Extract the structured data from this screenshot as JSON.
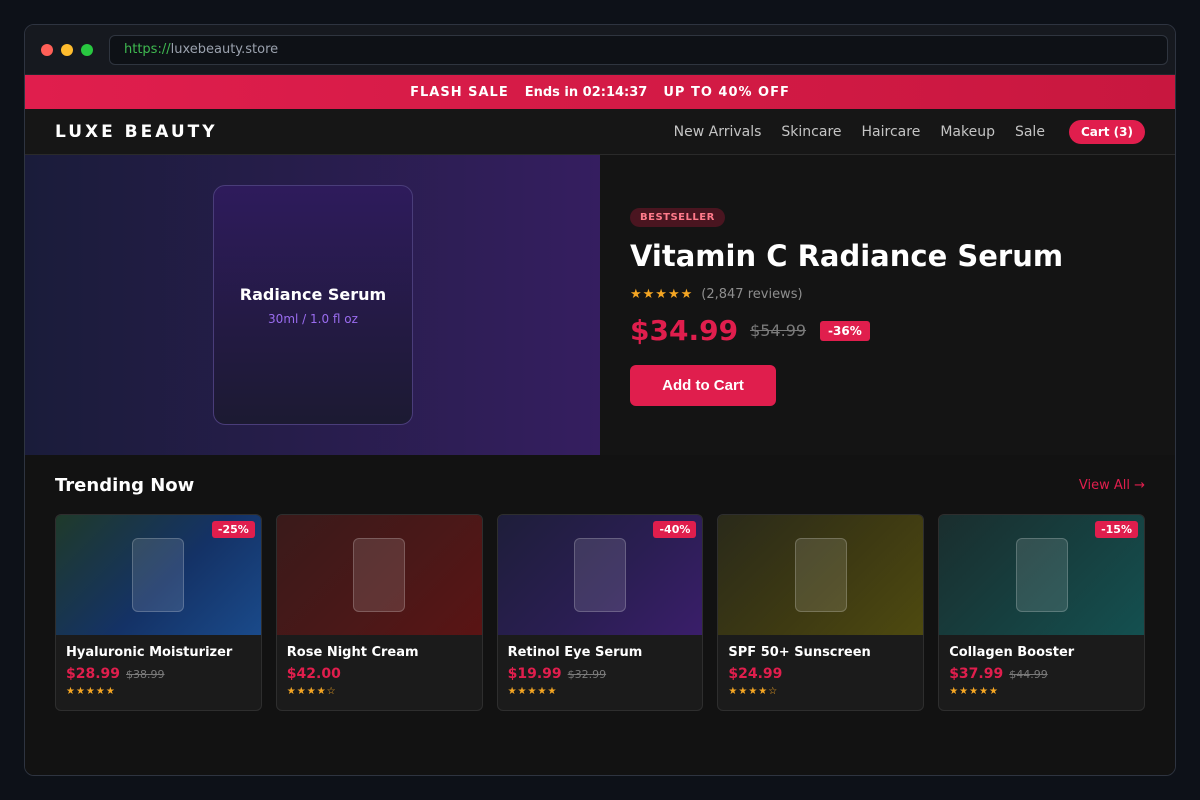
{
  "browser": {
    "url_scheme": "https://",
    "url_host": "luxebeauty.store"
  },
  "flash_bar": {
    "label": "FLASH SALE",
    "timer": "Ends in 02:14:37",
    "offer": "UP TO 40% OFF"
  },
  "nav": {
    "brand": "LUXE BEAUTY",
    "links": [
      "New Arrivals",
      "Skincare",
      "Haircare",
      "Makeup",
      "Sale"
    ],
    "cart_label": "Cart (3)"
  },
  "hero": {
    "product_name": "Radiance Serum",
    "product_size": "30ml / 1.0 fl oz",
    "badge": "BESTSELLER",
    "title": "Vitamin C Radiance Serum",
    "stars": "★★★★★",
    "reviews": "(2,847 reviews)",
    "price": "$34.99",
    "old_price": "$54.99",
    "discount": "-36%",
    "add_to_cart": "Add to Cart"
  },
  "trending": {
    "title": "Trending Now",
    "view_all": "View All →",
    "products": [
      {
        "name": "Hyaluronic Moisturizer",
        "price": "$28.99",
        "old_price": "$38.99",
        "discount": "-25%",
        "stars": "★★★★★",
        "gradient": [
          "#1f3a2a",
          "#143266",
          "#1a4a8a"
        ]
      },
      {
        "name": "Rose Night Cream",
        "price": "$42.00",
        "old_price": "",
        "discount": "",
        "stars": "★★★★☆",
        "gradient": [
          "#3a1a1a",
          "#4a1818",
          "#5a1414"
        ]
      },
      {
        "name": "Retinol Eye Serum",
        "price": "$19.99",
        "old_price": "$32.99",
        "discount": "-40%",
        "stars": "★★★★★",
        "gradient": [
          "#1e1e3a",
          "#2a1e52",
          "#3a1e6a"
        ]
      },
      {
        "name": "SPF 50+ Sunscreen",
        "price": "$24.99",
        "old_price": "",
        "discount": "",
        "stars": "★★★★☆",
        "gradient": [
          "#2a2a1a",
          "#3e3a12",
          "#4e4a10"
        ]
      },
      {
        "name": "Collagen Booster",
        "price": "$37.99",
        "old_price": "$44.99",
        "discount": "-15%",
        "stars": "★★★★★",
        "gradient": [
          "#1a2e2e",
          "#164040",
          "#145050"
        ]
      }
    ]
  }
}
